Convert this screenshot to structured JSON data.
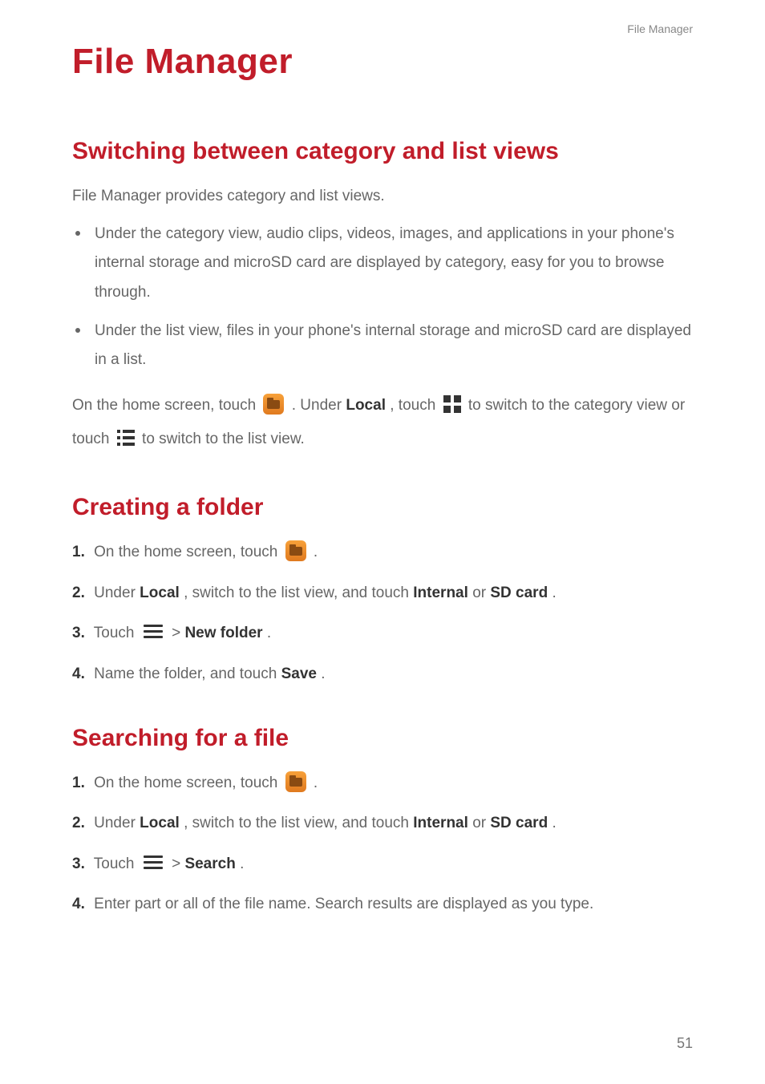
{
  "header": {
    "section_label": "File Manager"
  },
  "page_title": "File Manager",
  "s1": {
    "heading": "Switching between category and list views",
    "intro": "File Manager provides category and list views.",
    "bullets": [
      "Under the category view, audio clips, videos, images, and applications in your phone's internal storage and microSD card are displayed by category, easy for you to browse through.",
      "Under the list view, files in your phone's internal storage and microSD card are displayed in a list."
    ],
    "mix": {
      "a": "On the home screen, touch ",
      "b": " . Under ",
      "local": "Local",
      "c": ", touch ",
      "d": " to switch to the category view or touch ",
      "e": " to switch to the list view."
    }
  },
  "s2": {
    "heading": "Creating a folder",
    "steps": {
      "n1": "1.",
      "t1a": "On the home screen, touch ",
      "t1b": " .",
      "n2": "2.",
      "t2a": "Under ",
      "local": "Local",
      "t2b": ", switch to the list view, and touch ",
      "internal": "Internal",
      "or": " or ",
      "sd": "SD card",
      "t2c": ".",
      "n3": "3.",
      "t3a": "Touch ",
      "t3b": " > ",
      "newfolder": "New folder",
      "t3c": ".",
      "n4": "4.",
      "t4a": "Name the folder, and touch ",
      "save": "Save",
      "t4b": "."
    }
  },
  "s3": {
    "heading": "Searching for a file",
    "steps": {
      "n1": "1.",
      "t1a": "On the home screen, touch ",
      "t1b": " .",
      "n2": "2.",
      "t2a": "Under ",
      "local": "Local",
      "t2b": ", switch to the list view, and touch ",
      "internal": "Internal",
      "or": " or ",
      "sd": "SD card",
      "t2c": ".",
      "n3": "3.",
      "t3a": "Touch ",
      "t3b": " > ",
      "search": "Search",
      "t3c": ".",
      "n4": "4.",
      "t4": "Enter part or all of the file name. Search results are displayed as you type."
    }
  },
  "page_number": "51"
}
